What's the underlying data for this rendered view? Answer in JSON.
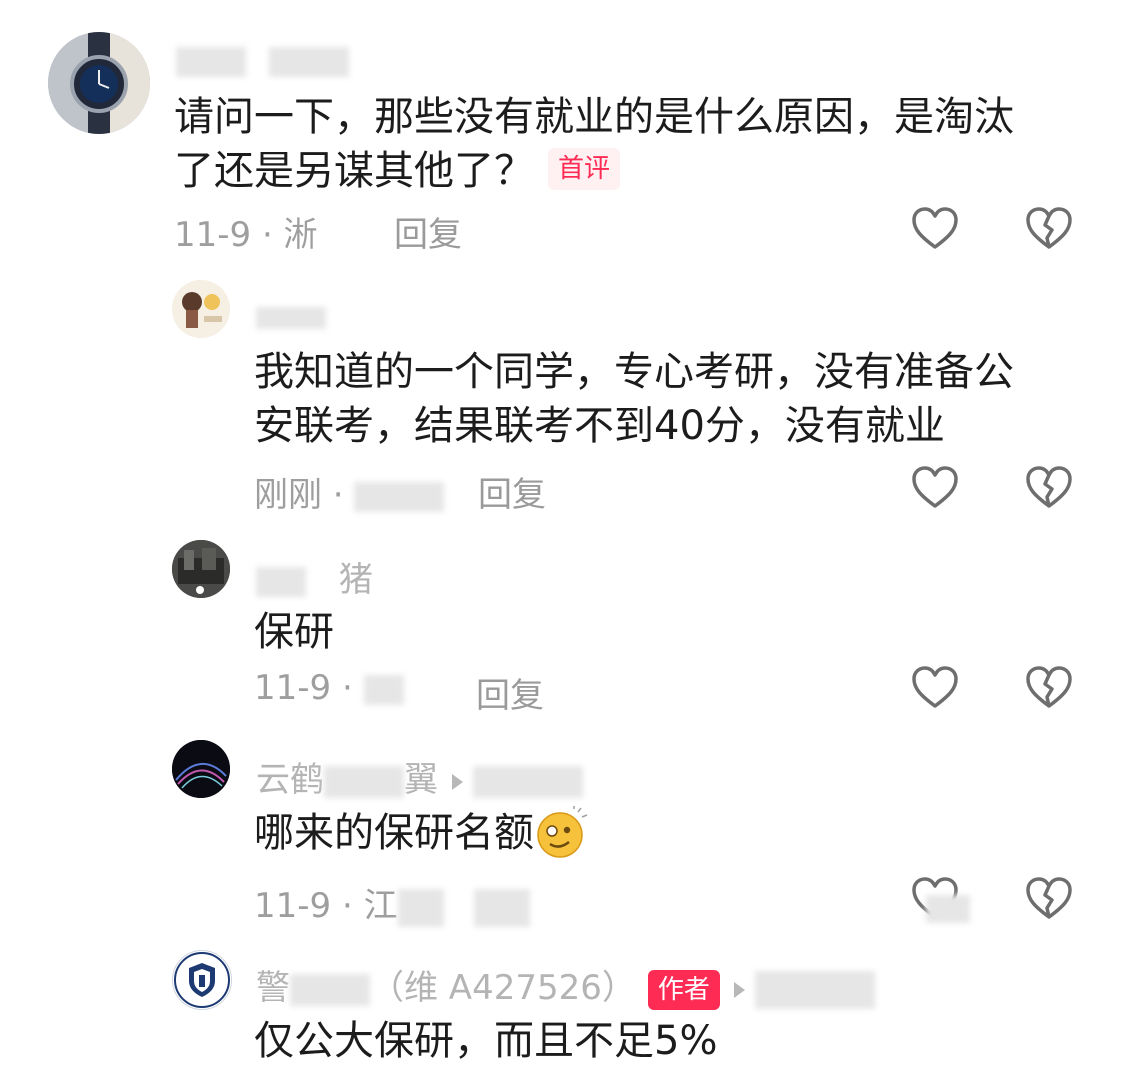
{
  "comments": [
    {
      "name_visible": "",
      "text_lines": [
        "请问一下，那些没有就业的是什么原因，是淘汰",
        "了还是另谋其他了？"
      ],
      "tag": "首评",
      "meta": "11-9 · 淅",
      "reply_label": "回复"
    },
    {
      "name_visible": "",
      "text_lines": [
        "我知道的一个同学，专心考研，没有准备公",
        "安联考，结果联考不到40分，没有就业"
      ],
      "meta": "刚刚 · ",
      "reply_label": "回复"
    },
    {
      "name_visible": "猪",
      "text_lines": [
        "保研"
      ],
      "meta": "11-9 · ",
      "reply_label": "回复"
    },
    {
      "name_start": "云鹤",
      "name_mid": "翼",
      "text_lines": [
        "哪来的保研名额"
      ],
      "emoji": "woozy-face-emoji",
      "meta": "11-9 · 江"
    },
    {
      "name_start": "警",
      "name_rest": "（维 A427526）",
      "tag": "作者",
      "text_lines": [
        "仅公大保研，而且不足5%"
      ]
    }
  ],
  "icons": {
    "like": "heart-outline-icon",
    "dislike": "broken-heart-icon"
  },
  "colors": {
    "accent": "#fe2c55",
    "meta": "#9e9e9e",
    "text": "#1c1c1c"
  }
}
